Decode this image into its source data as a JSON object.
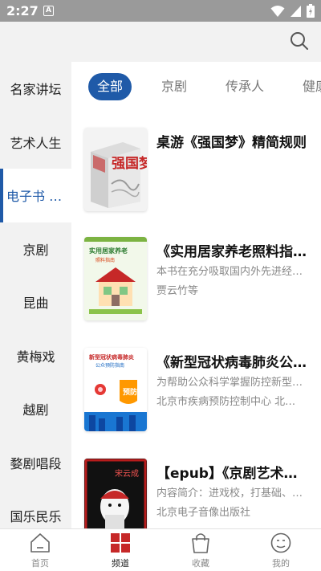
{
  "status_bar": {
    "time": "2:27",
    "notification_icon": "A",
    "icons": [
      "wifi-icon",
      "signal-icon",
      "battery-icon"
    ]
  },
  "search": {
    "icon": "search-icon"
  },
  "sidebar": {
    "items": [
      {
        "label": "名家讲坛",
        "active": false
      },
      {
        "label": "艺术人生",
        "active": false
      },
      {
        "label": "电子书 有声书",
        "active": true
      },
      {
        "label": "京剧",
        "active": false
      },
      {
        "label": "昆曲",
        "active": false
      },
      {
        "label": "黄梅戏",
        "active": false
      },
      {
        "label": "越剧",
        "active": false
      },
      {
        "label": "婺剧唱段",
        "active": false
      },
      {
        "label": "国乐民乐",
        "active": false
      }
    ]
  },
  "tabs": [
    {
      "label": "全部",
      "active": true
    },
    {
      "label": "京剧",
      "active": false
    },
    {
      "label": "传承人",
      "active": false
    },
    {
      "label": "健康",
      "active": false
    }
  ],
  "books": [
    {
      "title": "桌游《强国梦》精简规则",
      "desc": "",
      "author": "",
      "cover_text": "强国梦"
    },
    {
      "title": "《实用居家养老照料指南》",
      "desc": "本书在充分吸取国内外先进经验的基础上",
      "author": "贾云竹等",
      "cover_text": "实用居家养老照料指南"
    },
    {
      "title": "《新型冠状病毒肺炎公众预防指南》",
      "desc": "为帮助公众科学掌握防控新型冠状病毒肺炎",
      "author": "北京市疾病预防控制中心 北京市卫生健康委员会",
      "cover_text": "新型冠状病毒肺炎公众预防指南"
    },
    {
      "title": "【epub】《京剧艺术传承》",
      "desc": "内容简介：进戏校，打基础、学唱腔",
      "author": "北京电子音像出版社",
      "cover_text": "宋云成"
    }
  ],
  "bottom_nav": [
    {
      "label": "首页",
      "icon": "home-icon",
      "active": false
    },
    {
      "label": "频道",
      "icon": "channel-grid-icon",
      "active": true
    },
    {
      "label": "收藏",
      "icon": "favorites-bag-icon",
      "active": false
    },
    {
      "label": "我的",
      "icon": "profile-icon",
      "active": false
    }
  ],
  "colors": {
    "accent": "#1f5aa8",
    "sidebar_bg": "#f2f2f2",
    "nav_active": "#c62828",
    "status_bar": "#9a9a9a"
  }
}
